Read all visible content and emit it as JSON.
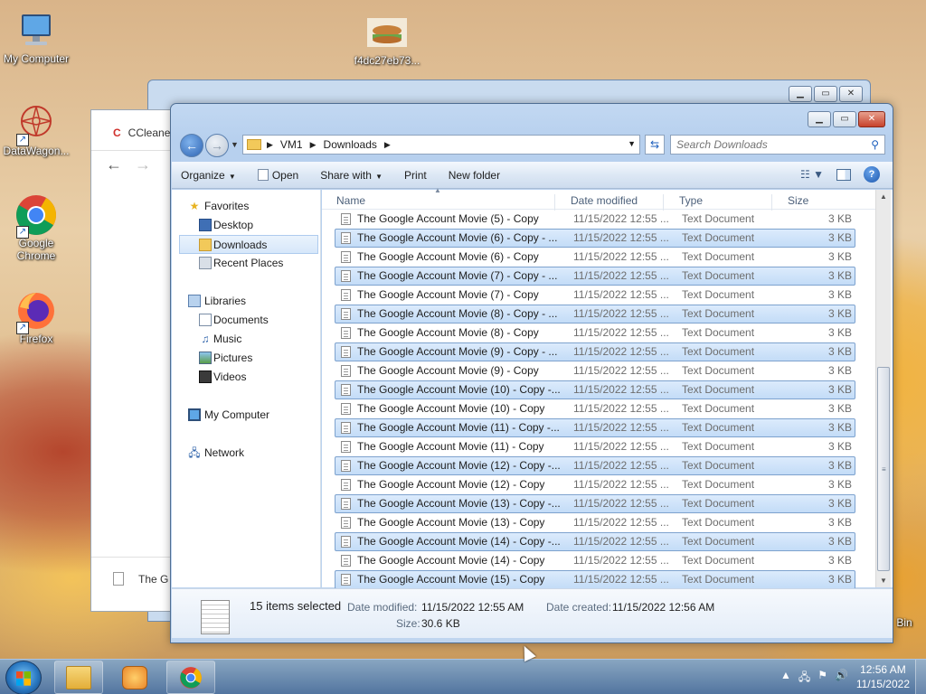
{
  "desktop": {
    "icons": [
      {
        "label": "My Computer"
      },
      {
        "label": "DataWagon..."
      },
      {
        "label": "Google Chrome"
      },
      {
        "label": "Firefox"
      },
      {
        "label": "f4dc27eb73..."
      },
      {
        "label": "Bin"
      }
    ]
  },
  "chrome_window": {
    "tab_title": "CCleane",
    "download_item": "The G"
  },
  "explorer": {
    "breadcrumbs": [
      "VM1",
      "Downloads"
    ],
    "search_placeholder": "Search Downloads",
    "toolbar": {
      "organize": "Organize",
      "open": "Open",
      "share_with": "Share with",
      "print": "Print",
      "new_folder": "New folder"
    },
    "nav": {
      "favorites": "Favorites",
      "desktop": "Desktop",
      "downloads": "Downloads",
      "recent_places": "Recent Places",
      "libraries": "Libraries",
      "documents": "Documents",
      "music": "Music",
      "pictures": "Pictures",
      "videos": "Videos",
      "my_computer": "My Computer",
      "network": "Network"
    },
    "columns": {
      "name": "Name",
      "date": "Date modified",
      "type": "Type",
      "size": "Size"
    },
    "files": [
      {
        "name": "The Google Account Movie (5) - Copy",
        "date": "11/15/2022 12:55 ...",
        "type": "Text Document",
        "size": "3 KB",
        "selected": false
      },
      {
        "name": "The Google Account Movie (6) - Copy - ...",
        "date": "11/15/2022 12:55 ...",
        "type": "Text Document",
        "size": "3 KB",
        "selected": true
      },
      {
        "name": "The Google Account Movie (6) - Copy",
        "date": "11/15/2022 12:55 ...",
        "type": "Text Document",
        "size": "3 KB",
        "selected": false
      },
      {
        "name": "The Google Account Movie (7) - Copy - ...",
        "date": "11/15/2022 12:55 ...",
        "type": "Text Document",
        "size": "3 KB",
        "selected": true
      },
      {
        "name": "The Google Account Movie (7) - Copy",
        "date": "11/15/2022 12:55 ...",
        "type": "Text Document",
        "size": "3 KB",
        "selected": false
      },
      {
        "name": "The Google Account Movie (8) - Copy - ...",
        "date": "11/15/2022 12:55 ...",
        "type": "Text Document",
        "size": "3 KB",
        "selected": true
      },
      {
        "name": "The Google Account Movie (8) - Copy",
        "date": "11/15/2022 12:55 ...",
        "type": "Text Document",
        "size": "3 KB",
        "selected": false
      },
      {
        "name": "The Google Account Movie (9) - Copy - ...",
        "date": "11/15/2022 12:55 ...",
        "type": "Text Document",
        "size": "3 KB",
        "selected": true
      },
      {
        "name": "The Google Account Movie (9) - Copy",
        "date": "11/15/2022 12:55 ...",
        "type": "Text Document",
        "size": "3 KB",
        "selected": false
      },
      {
        "name": "The Google Account Movie (10) - Copy -...",
        "date": "11/15/2022 12:55 ...",
        "type": "Text Document",
        "size": "3 KB",
        "selected": true
      },
      {
        "name": "The Google Account Movie (10) - Copy",
        "date": "11/15/2022 12:55 ...",
        "type": "Text Document",
        "size": "3 KB",
        "selected": false
      },
      {
        "name": "The Google Account Movie (11) - Copy -...",
        "date": "11/15/2022 12:55 ...",
        "type": "Text Document",
        "size": "3 KB",
        "selected": true
      },
      {
        "name": "The Google Account Movie (11) - Copy",
        "date": "11/15/2022 12:55 ...",
        "type": "Text Document",
        "size": "3 KB",
        "selected": false
      },
      {
        "name": "The Google Account Movie (12) - Copy -...",
        "date": "11/15/2022 12:55 ...",
        "type": "Text Document",
        "size": "3 KB",
        "selected": true
      },
      {
        "name": "The Google Account Movie (12) - Copy",
        "date": "11/15/2022 12:55 ...",
        "type": "Text Document",
        "size": "3 KB",
        "selected": false
      },
      {
        "name": "The Google Account Movie (13) - Copy -...",
        "date": "11/15/2022 12:55 ...",
        "type": "Text Document",
        "size": "3 KB",
        "selected": true
      },
      {
        "name": "The Google Account Movie (13) - Copy",
        "date": "11/15/2022 12:55 ...",
        "type": "Text Document",
        "size": "3 KB",
        "selected": false
      },
      {
        "name": "The Google Account Movie (14) - Copy -...",
        "date": "11/15/2022 12:55 ...",
        "type": "Text Document",
        "size": "3 KB",
        "selected": true
      },
      {
        "name": "The Google Account Movie (14) - Copy",
        "date": "11/15/2022 12:55 ...",
        "type": "Text Document",
        "size": "3 KB",
        "selected": false
      },
      {
        "name": "The Google Account Movie (15) - Copy",
        "date": "11/15/2022 12:55 ...",
        "type": "Text Document",
        "size": "3 KB",
        "selected": true
      }
    ],
    "details": {
      "count": "15 items selected",
      "date_modified_label": "Date modified:",
      "date_modified": "11/15/2022 12:55 AM",
      "date_created_label": "Date created:",
      "date_created": "11/15/2022 12:56 AM",
      "size_label": "Size:",
      "size": "30.6 KB"
    }
  },
  "taskbar": {
    "time": "12:56 AM",
    "date": "11/15/2022"
  },
  "colors": {
    "selection": "#c3dcf7",
    "selection_border": "#7da2ce",
    "accent": "#1d5fbd"
  }
}
